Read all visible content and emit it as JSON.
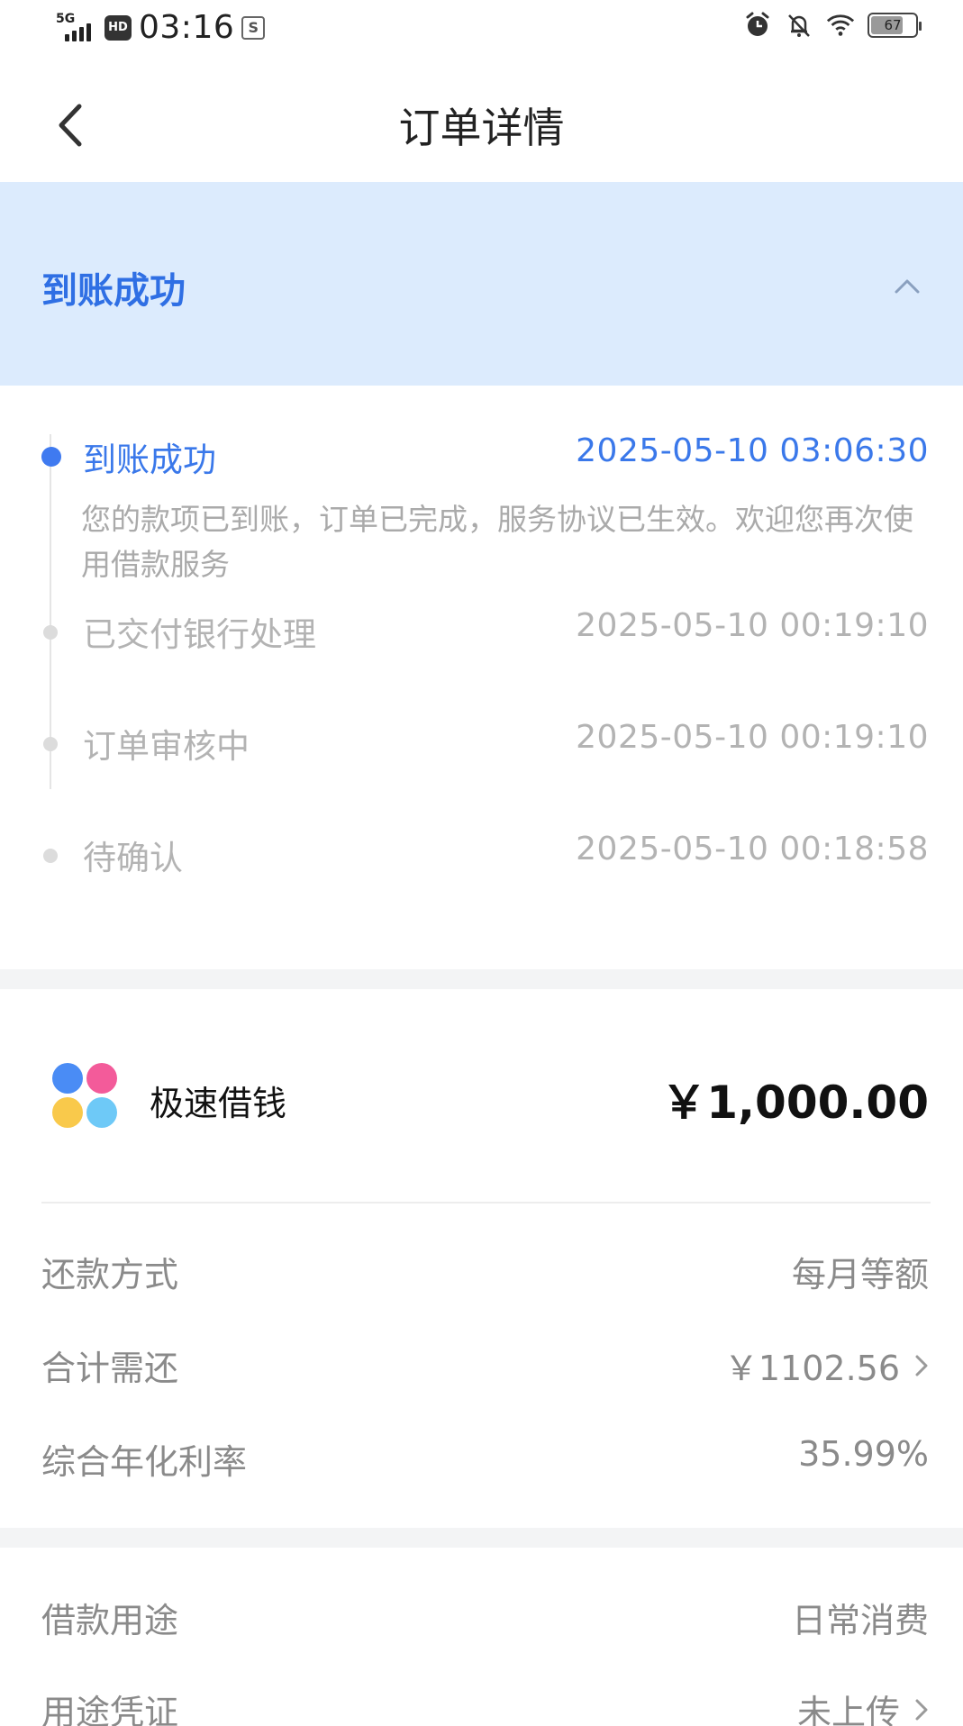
{
  "status_bar": {
    "network": "5G",
    "hd_label": "HD",
    "time": "03:16",
    "s_badge": "S",
    "battery_level": "67",
    "icons": [
      "alarm-icon",
      "bell-muted-icon",
      "wifi-icon",
      "battery-icon"
    ]
  },
  "nav": {
    "title": "订单详情"
  },
  "banner": {
    "title": "到账成功"
  },
  "timeline": {
    "items": [
      {
        "label": "到账成功",
        "time": "2025-05-10 03:06:30",
        "description": "您的款项已到账，订单已完成，服务协议已生效。欢迎您再次使用借款服务",
        "state": "active"
      },
      {
        "label": "已交付银行处理",
        "time": "2025-05-10 00:19:10",
        "state": "inactive"
      },
      {
        "label": "订单审核中",
        "time": "2025-05-10 00:19:10",
        "state": "inactive"
      },
      {
        "label": "待确认",
        "time": "2025-05-10 00:18:58",
        "state": "inactive"
      }
    ]
  },
  "product": {
    "name": "极速借钱",
    "amount": "￥1,000.00"
  },
  "details": [
    {
      "label": "还款方式",
      "value": "每月等额"
    },
    {
      "label": "合计需还",
      "value": "￥1102.56"
    },
    {
      "label": "综合年化利率",
      "value": "35.99%"
    }
  ],
  "extra": [
    {
      "label": "借款用途",
      "value": "日常消费"
    },
    {
      "label": "用途凭证",
      "value": "未上传"
    }
  ],
  "colors": {
    "accent": "#3a78ea",
    "banner_bg": "#dcebfd",
    "muted_text": "#8a8a8a",
    "inactive_text": "#b3b3b3"
  }
}
